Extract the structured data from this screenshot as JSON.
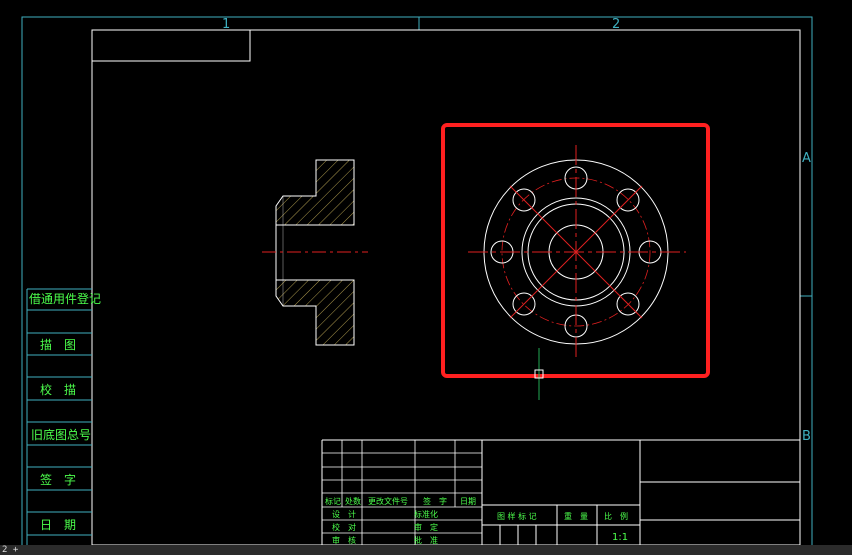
{
  "drawing": {
    "border_zone_numbers": [
      "1",
      "2"
    ],
    "border_zone_letters": [
      "A",
      "B"
    ],
    "left_column_labels": [
      "借通用件登记",
      "描　图",
      "校　描",
      "旧底图总号",
      "签　字",
      "日　期"
    ],
    "title_block": {
      "revision_headers": [
        "标记",
        "处数",
        "更改文件号",
        "签　字",
        "日期"
      ],
      "left_roles": [
        "设　计",
        "校　对",
        "审　核"
      ],
      "right_roles": [
        "标准化",
        "审　定",
        "批　准"
      ],
      "info_headers": [
        "图 样 标 记",
        "重　量",
        "比　例"
      ],
      "scale_value": "1:1"
    }
  },
  "colors": {
    "frame": "#ffffff",
    "grid_cyan": "#3fb0c0",
    "text_green": "#4cff4c",
    "centerline": "#e02020",
    "hatch": "#d8c060",
    "highlight": "#ff2020",
    "crosshair": "#22aa55"
  },
  "status": {
    "text": "2 +"
  }
}
